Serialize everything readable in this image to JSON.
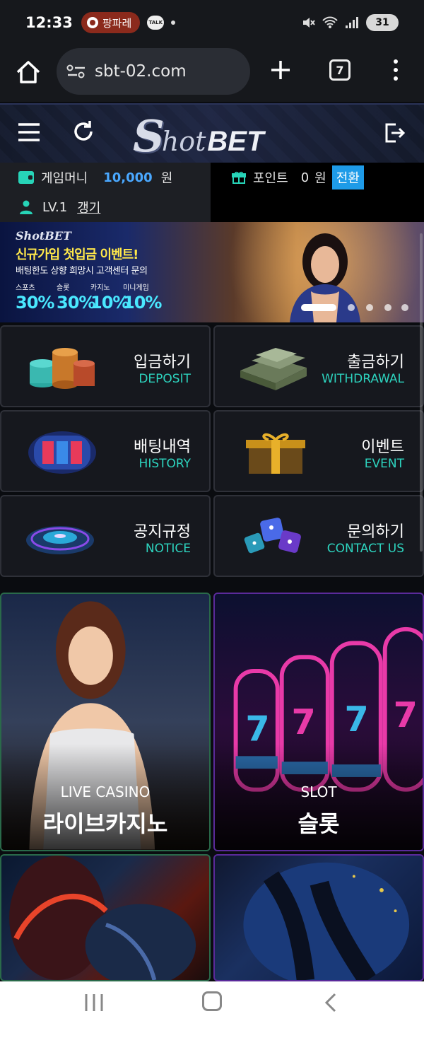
{
  "status_bar": {
    "time": "12:33",
    "notification_chip": "팡파레",
    "talk_label": "TALK",
    "battery": "31"
  },
  "browser": {
    "url": "sbt-02.com",
    "tab_count": "7"
  },
  "header": {
    "logo_s": "S",
    "logo_hot": "hot",
    "logo_bet": "BET"
  },
  "account": {
    "money_label": "게임머니",
    "money_value": "10,000",
    "money_unit": "원",
    "point_label": "포인트",
    "point_value": "0",
    "point_unit": "원",
    "convert_label": "전환",
    "level_label": "LV.1",
    "refresh_label": "갱기"
  },
  "banner": {
    "logo": "ShotBET",
    "title": "신규가입 첫입금 이벤트!",
    "subtitle": "배팅한도 상향 희망시 고객센터 문의",
    "categories": [
      "스포츠",
      "슬롯",
      "카지노",
      "미니게임"
    ],
    "percents": [
      "30%",
      "30%",
      "10%",
      "10%"
    ],
    "slide_count": 5,
    "active_slide": 1
  },
  "menu": [
    {
      "ko": "입금하기",
      "en": "DEPOSIT",
      "icon": "coins-icon"
    },
    {
      "ko": "출금하기",
      "en": "WITHDRAWAL",
      "icon": "cash-stack-icon"
    },
    {
      "ko": "배팅내역",
      "en": "HISTORY",
      "icon": "slot-reel-icon"
    },
    {
      "ko": "이벤트",
      "en": "EVENT",
      "icon": "gift-box-icon"
    },
    {
      "ko": "공지규정",
      "en": "NOTICE",
      "icon": "roulette-icon"
    },
    {
      "ko": "문의하기",
      "en": "CONTACT US",
      "icon": "dice-icon"
    }
  ],
  "games": {
    "casino_en": "LIVE CASINO",
    "casino_ko": "라이브카지노",
    "slot_en": "SLOT",
    "slot_ko": "슬롯"
  },
  "colors": {
    "accent_teal": "#2dd4bf",
    "money_blue": "#4aa8ff",
    "convert_bg": "#1e9be8",
    "banner_yellow": "#ffe84a",
    "banner_cyan": "#4ae8ff"
  }
}
